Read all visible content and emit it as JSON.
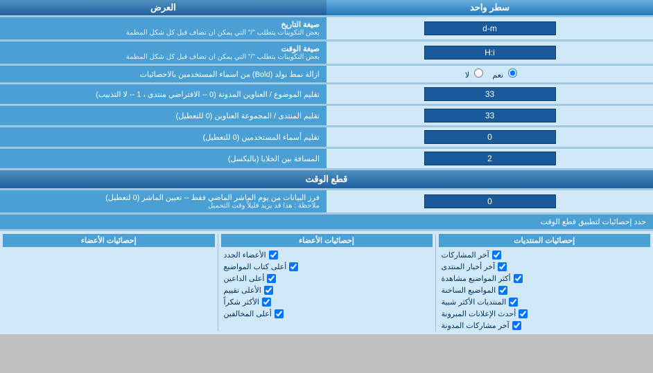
{
  "title": "العرض",
  "rows": [
    {
      "label": "سطر واحد",
      "type": "select",
      "value": "سطر واحد",
      "side_label": "العرض"
    },
    {
      "label": "صيغة التاريخ",
      "sublabel": "بعض التكوينات يتطلب \"/\" التي يمكن ان تضاف قبل كل شكل المطمة",
      "type": "input",
      "value": "d-m"
    },
    {
      "label": "صيغة الوقت",
      "sublabel": "بعض التكوينات يتطلب \"/\" التي يمكن ان تضاف قبل كل شكل المطمة",
      "type": "input",
      "value": "H:i"
    },
    {
      "label": "ازالة نمط بولد (Bold) من اسماء المستخدمين بالاحصائيات",
      "type": "radio",
      "options": [
        "نعم",
        "لا"
      ],
      "selected": "نعم"
    },
    {
      "label": "تقليم الموضوع / العناوين المدونة (0 -- الافتراضي منتدى ، 1 -- لا التذبيب)",
      "type": "input",
      "value": "33"
    },
    {
      "label": "تقليم المنتدى / المجموعة العناوين (0 للتعطيل)",
      "type": "input",
      "value": "33"
    },
    {
      "label": "تقليم أسماء المستخدمين (0 للتعطيل)",
      "type": "input",
      "value": "0"
    },
    {
      "label": "المسافة بين الخلايا (بالبكسل)",
      "type": "input",
      "value": "2"
    }
  ],
  "cut_section": {
    "title": "قطع الوقت",
    "row_label": "فرز البيانات من يوم الماشر الماضي فقط -- تعيين الماشر (0 لتعطيل)",
    "row_note": "ملاحظة : هذا قد يزيد قليلاً وقت التحميل",
    "value": "0",
    "limit_label": "حدد إحصائيات لتطبيق قطع الوقت"
  },
  "stats": {
    "col1_title": "إحصائيات المنتديات",
    "col1_items": [
      "آخر المشاركات",
      "آخر أخبار المنتدى",
      "أكثر المواضيع مشاهدة",
      "المواضيع الساخنة",
      "المنتديات الأكثر شبية",
      "أحدث الإعلانات المبرونة",
      "آخر مشاركات المدونة"
    ],
    "col2_title": "إحصائيات الأعضاء",
    "col2_items": [
      "الأعضاء الجدد",
      "أعلى كتاب المواضيع",
      "أعلى الداعين",
      "الأعلى تقييم",
      "الأكثر شكراً",
      "أعلى المخالفين"
    ],
    "col3_title": "إحصائيات الأعضاء",
    "col3_label": "إحصائيات الأعضاء"
  },
  "icons": {
    "dropdown": "▼",
    "checkbox_checked": "☑",
    "radio_on": "●",
    "radio_off": "○"
  }
}
